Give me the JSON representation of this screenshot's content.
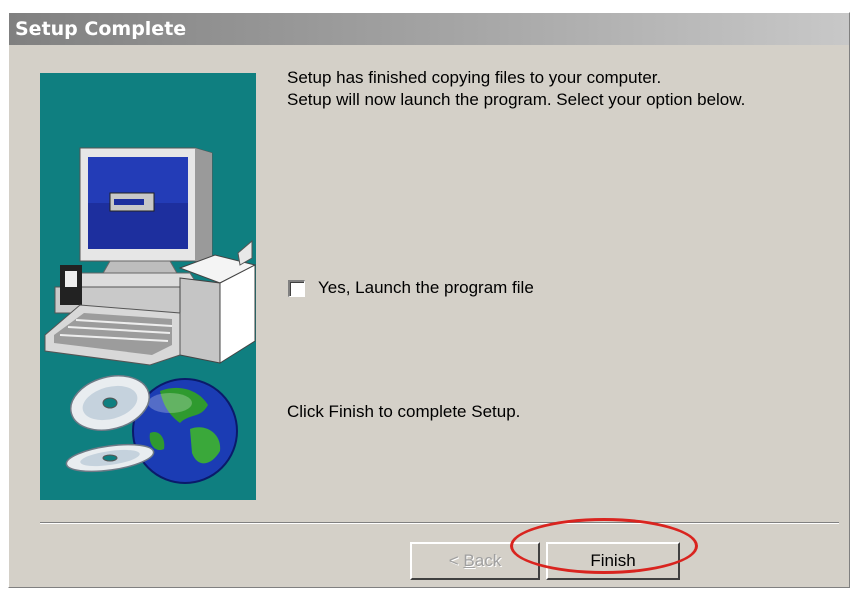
{
  "window": {
    "title": "Setup Complete"
  },
  "illustration": {
    "background_color": "#0f7f80",
    "icons": [
      "computer-monitor-icon",
      "computer-case-icon",
      "keyboard-icon",
      "cd-disc-icon",
      "globe-icon"
    ]
  },
  "content": {
    "message_line1": "Setup has finished copying files to your computer.",
    "message_line2": "Setup will now launch the program. Select your option below.",
    "launch_option": {
      "label": "Yes, Launch the program file",
      "checked": false
    },
    "finish_instruction": "Click Finish to complete Setup."
  },
  "buttons": {
    "back_prefix": "< ",
    "back_mnemonic": "B",
    "back_rest": "ack",
    "back_enabled": false,
    "finish_label": "Finish"
  },
  "annotation": {
    "highlight_color": "#d9241f",
    "target": "finish-button"
  }
}
